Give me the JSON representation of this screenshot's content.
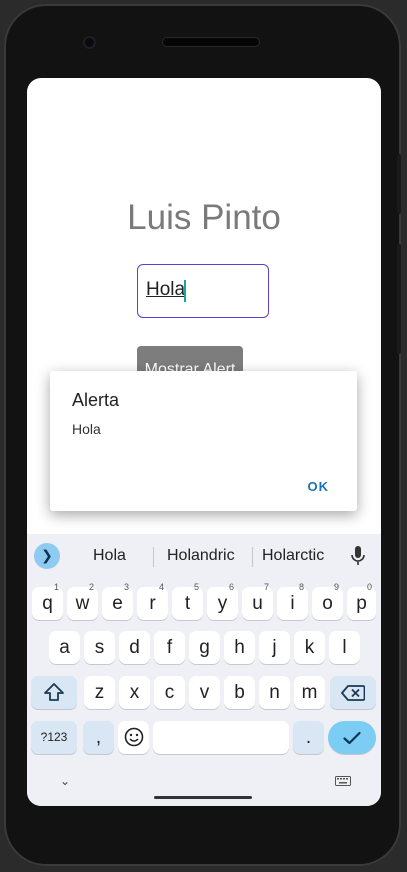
{
  "app": {
    "title": "Luis Pinto",
    "input_value": "Hola",
    "button_label": "Mostrar Alert"
  },
  "dialog": {
    "title": "Alerta",
    "message": "Hola",
    "ok_label": "OK"
  },
  "keyboard": {
    "suggestions": [
      "Hola",
      "Holandric",
      "Holarctic"
    ],
    "row1": [
      "q",
      "w",
      "e",
      "r",
      "t",
      "y",
      "u",
      "i",
      "o",
      "p"
    ],
    "row1_hints": [
      "1",
      "2",
      "3",
      "4",
      "5",
      "6",
      "7",
      "8",
      "9",
      "0"
    ],
    "row2": [
      "a",
      "s",
      "d",
      "f",
      "g",
      "h",
      "j",
      "k",
      "l"
    ],
    "row3": [
      "z",
      "x",
      "c",
      "v",
      "b",
      "n",
      "m"
    ],
    "symbols_label": "?123",
    "comma_label": ",",
    "period_label": ".",
    "accent_color": "#7ccdf3"
  }
}
